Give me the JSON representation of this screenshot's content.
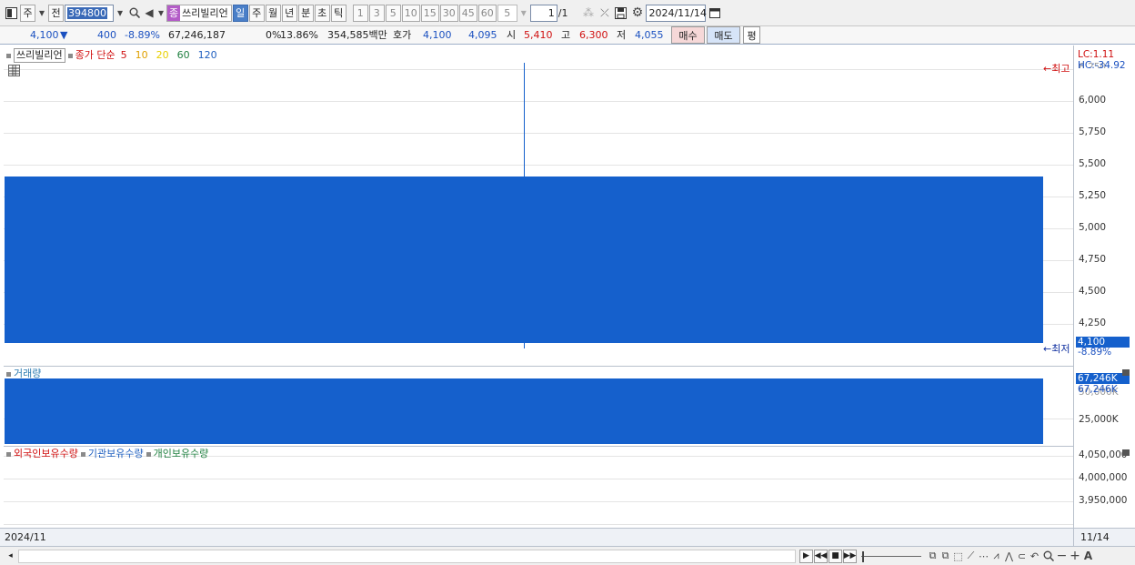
{
  "toolbar": {
    "period_label": "주",
    "jeon_label": "전",
    "code": "394800",
    "name_tag": "종",
    "stock_name": "쓰리빌리언",
    "intervals": [
      "일",
      "주",
      "월",
      "년",
      "분",
      "초",
      "틱"
    ],
    "selected_interval": "일",
    "numbers": [
      "1",
      "3",
      "5",
      "10",
      "15",
      "30",
      "45",
      "60"
    ],
    "count_value": "5",
    "page_value": "1",
    "page_total": "/1",
    "date": "2024/11/14"
  },
  "quote": {
    "price": "4,100",
    "change_arrow": "▼",
    "change": "400",
    "change_pct": "-8.89%",
    "volume": "67,246,187",
    "pct_zero": "0%",
    "turnover": "13.86%",
    "amount": "354,585백만",
    "hoga_label": "호가",
    "ask": "4,100",
    "bid": "4,095",
    "open_label": "시",
    "open": "5,410",
    "high_label": "고",
    "high": "6,300",
    "low_label": "저",
    "low": "4,055",
    "buy_label": "매수",
    "sell_label": "매도",
    "avg_label": "평"
  },
  "legend": {
    "name": "쓰리빌리언",
    "ma_label": "종가 단순",
    "ma_periods": [
      {
        "label": "5",
        "color": "#d01010"
      },
      {
        "label": "10",
        "color": "#e0a000"
      },
      {
        "label": "20",
        "color": "#e8d000"
      },
      {
        "label": "60",
        "color": "#208040"
      },
      {
        "label": "120",
        "color": "#2060c0"
      }
    ],
    "volume_label": "거래량",
    "holdings": [
      {
        "label": "외국인보유수량",
        "color": "#d01010"
      },
      {
        "label": "기관보유수량",
        "color": "#2060c0"
      },
      {
        "label": "개인보유수량",
        "color": "#208040"
      }
    ]
  },
  "price_axis": {
    "ticks": [
      "6,000",
      "5,750",
      "5,500",
      "5,250",
      "5,000",
      "4,750",
      "4,500",
      "4,250"
    ],
    "partial_tick": "6,250",
    "lc": "LC:1.11",
    "hc": "HC:-34.92",
    "max_marker": "최고",
    "min_marker": "최저",
    "last_price": "4,100",
    "last_pct": "-8.89%"
  },
  "volume_axis": {
    "tag1": "67,246K",
    "tag2": "67,246K",
    "hidden_tick": "50,000K",
    "tick": "25,000K"
  },
  "holdings_axis": {
    "ticks": [
      "4,050,000",
      "4,000,000",
      "3,950,000"
    ]
  },
  "date_axis": {
    "left": "2024/11",
    "right": "11/14"
  },
  "chart_data": {
    "type": "candlestick",
    "date": "2024/11/14",
    "open": 5410,
    "high": 6300,
    "low": 4055,
    "close": 4100,
    "volume": 67246187,
    "price_range": [
      4055,
      6300
    ],
    "volume_range": [
      0,
      67246187
    ]
  },
  "colors": {
    "down": "#1560cc",
    "buy_bg": "#f6d8d8",
    "sell_bg": "#d6e4f8"
  }
}
